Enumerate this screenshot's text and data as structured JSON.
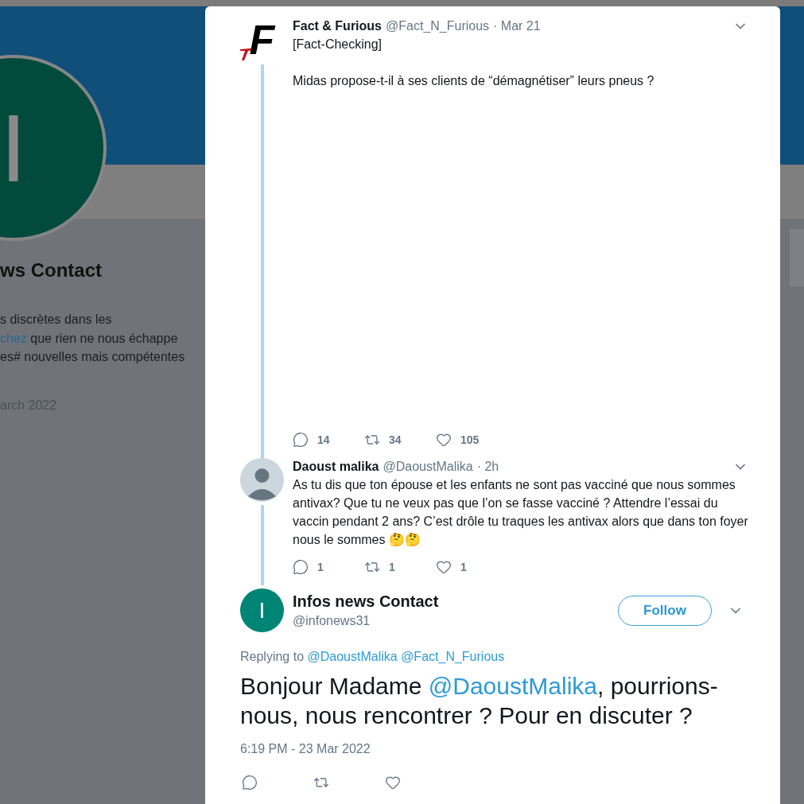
{
  "profile": {
    "avatar_letter": "I",
    "name": "ws Contact",
    "bio": [
      {
        "text": "s discrètes dans les"
      },
      {
        "link": "chez",
        "text": " que rien ne nous échappe"
      },
      {
        "text": "es# nouvelles mais compétentes"
      }
    ],
    "joined": "arch 2022"
  },
  "thread": [
    {
      "name": "Fact & Furious",
      "handle": "@Fact_N_Furious",
      "time": "· Mar 21",
      "avatar": {
        "kind": "logo",
        "letter": "F"
      },
      "paragraphs": [
        "[Fact-Checking]",
        "Midas propose-t-il à ses clients de “démagnétiser” leurs pneus ?"
      ],
      "replies": "14",
      "retweets": "34",
      "likes": "105"
    },
    {
      "name": "Daoust malika",
      "handle": "@DaoustMalika",
      "time": "· 2h",
      "avatar": {
        "kind": "default"
      },
      "paragraphs": [
        "As tu dis que ton épouse et les enfants ne sont pas vacciné que nous sommes antivax? Que tu ne veux pas que l’on se fasse vacciné ? Attendre l’essai du vaccin pendant 2 ans? C’est drôle tu traques les antivax alors que dans ton foyer nous le sommes 🤔🤔"
      ],
      "replies": "1",
      "retweets": "1",
      "likes": "1"
    }
  ],
  "main_tweet": {
    "name": "Infos news Contact",
    "handle": "@infonews31",
    "avatar_letter": "I",
    "follow_button": "Follow",
    "replying_label": "Replying to",
    "replying_to": [
      "@DaoustMalika",
      "@Fact_N_Furious"
    ],
    "text": [
      {
        "kind": "text",
        "text": "Bonjour Madame "
      },
      {
        "kind": "mention",
        "text": "@DaoustMalika"
      },
      {
        "kind": "text",
        "text": ", pourrions-nous, nous rencontrer ? Pour en discuter ?"
      }
    ],
    "timestamp": "6:19 PM - 23 Mar 2022"
  }
}
